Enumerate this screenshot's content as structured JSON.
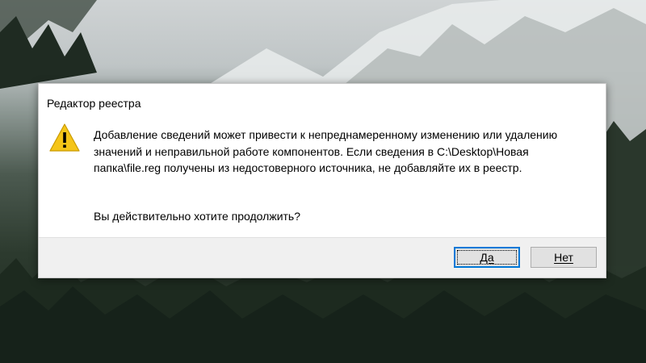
{
  "dialog": {
    "title": "Редактор реестра",
    "icon": "warning-icon",
    "message": "Добавление сведений может привести к непреднамеренному изменению или удалению значений и неправильной работе компонентов. Если сведения в C:\\Desktop\\Новая папка\\file.reg получены из недостоверного источника, не добавляйте их в реестр.",
    "question": "Вы действительно хотите продолжить?",
    "buttons": {
      "yes": "Да",
      "no": "Нет"
    }
  },
  "colors": {
    "warning": "#f5c518",
    "focus_border": "#0078d7",
    "footer_bg": "#f0f0f0"
  }
}
